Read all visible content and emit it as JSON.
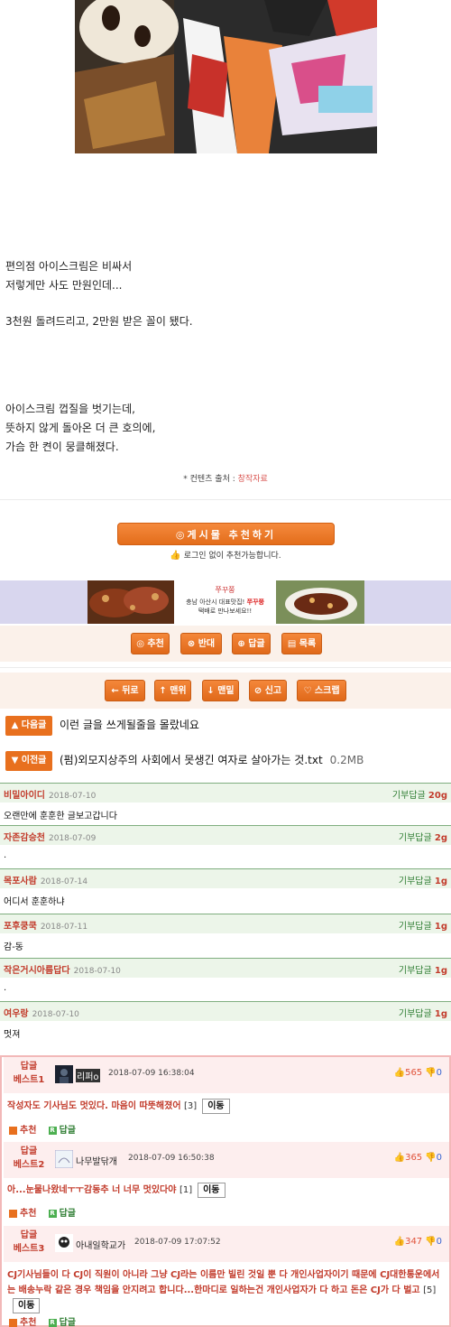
{
  "article": {
    "para1": [
      "편의점 아이스크림은 비싸서",
      "저렇게만 사도 만원인데..."
    ],
    "para2": [
      "3천원 돌려드리고, 2만원 받은 꼴이 됐다."
    ],
    "para3": [
      "아이스크림 껍질을 벗기는데,",
      "뜻하지 않게 돌아온 더 큰 호의에,",
      "가슴 한 켠이 뭉클해졌다."
    ],
    "source_label": "* 컨텐츠 출처 :",
    "source_value": "창작자료"
  },
  "recommend": {
    "button": "◎게시물 추천하기",
    "note": "로그인 없이 추천가능합니다."
  },
  "ad": {
    "logo": "쭈꾸쭝",
    "line1_prefix": "충남 아산시 대표맛집!",
    "line1_brand": "쭈꾸쭝",
    "line2": "택배로 만나보세요!!"
  },
  "actions_row1": [
    "◎ 추천",
    "⊗ 반대",
    "⊕ 답글",
    "▤ 목록"
  ],
  "actions_row2": [
    "← 뒤로",
    "↑ 맨위",
    "↓ 맨밑",
    "⊘ 신고",
    "♡ 스크랩"
  ],
  "nav": {
    "next_label": "▲ 다음글",
    "next_title": "이런 글을 쓰게될줄을 몰랐네요",
    "prev_label": "▼ 이전글",
    "prev_title": "(펌)외모지상주의 사회에서 못생긴 여자로 살아가는 것.txt",
    "prev_size": "0.2MB"
  },
  "comments": [
    {
      "author": "비밀아이디",
      "date": "2018-07-10",
      "gift_label": "기부답글",
      "gift_value": "20g",
      "text": "오랜만에 훈훈한 글보고갑니다"
    },
    {
      "author": "자존감승천",
      "date": "2018-07-09",
      "gift_label": "기부답글",
      "gift_value": "2g",
      "text": "."
    },
    {
      "author": "목포사람",
      "date": "2018-07-14",
      "gift_label": "기부답글",
      "gift_value": "1g",
      "text": "어디서 훈훈하냐"
    },
    {
      "author": "포후쿵쿡",
      "date": "2018-07-11",
      "gift_label": "기부답글",
      "gift_value": "1g",
      "text": "감-동"
    },
    {
      "author": "작은거시아름답다",
      "date": "2018-07-10",
      "gift_label": "기부답글",
      "gift_value": "1g",
      "text": "."
    },
    {
      "author": "여우랑",
      "date": "2018-07-10",
      "gift_label": "기부답글",
      "gift_value": "1g",
      "text": "멋져"
    }
  ],
  "best": [
    {
      "tag1": "답글",
      "tag2": "베스트1",
      "name": "리퍼o",
      "date": "2018-07-09 16:38:04",
      "up": "565",
      "down": "0",
      "text": "작성자도 기사님도 멋있다. 마음이 따뜻해졌어",
      "count": "[3]",
      "move": "이동",
      "rec": "추천",
      "reply": "답글"
    },
    {
      "tag1": "답글",
      "tag2": "베스트2",
      "name": "나무발닦개",
      "date": "2018-07-09 16:50:38",
      "up": "365",
      "down": "0",
      "text": "아...눈물나왔네ㅜㅜ감동추 너 너무 멋있다야",
      "count": "[1]",
      "move": "이동",
      "rec": "추천",
      "reply": "답글"
    },
    {
      "tag1": "답글",
      "tag2": "베스트3",
      "name": "아내일학교가",
      "date": "2018-07-09 17:07:52",
      "up": "347",
      "down": "0",
      "text": "CJ기사님들이 다 CJ이 직원이 아니라 그냥 CJ라는 이름만 빌린 것일 뿐 다 개인사업자이기 때문에 CJ대한통운에서는 배송누락 같은 경우 책임을 안지려고 합니다...한마디로 일하는건 개인사업자가 다 하고 돈은 CJ가 다 벌고",
      "count": "[5]",
      "move": "이동",
      "rec": "추천",
      "reply": "답글"
    }
  ]
}
